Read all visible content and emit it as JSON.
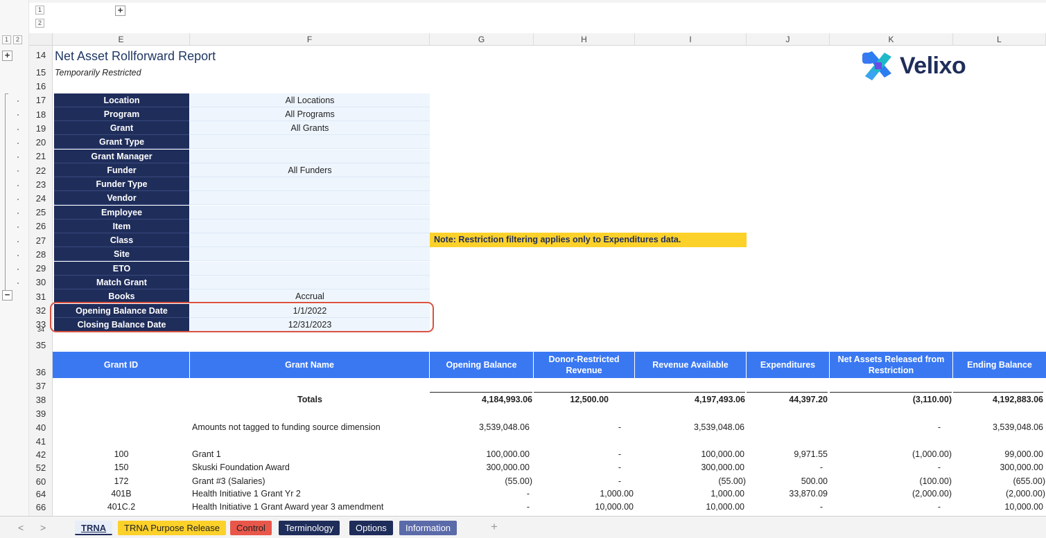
{
  "outline": {
    "levels": [
      "1",
      "2"
    ],
    "expand_label": "+",
    "collapse_label": "−"
  },
  "columns": [
    "E",
    "F",
    "G",
    "H",
    "I",
    "J",
    "K",
    "L"
  ],
  "rows": {
    "r14": "14",
    "r15": "15",
    "r16": "16",
    "r17": "17",
    "r18": "18",
    "r19": "19",
    "r20": "20",
    "r21": "21",
    "r22": "22",
    "r23": "23",
    "r24": "24",
    "r25": "25",
    "r26": "26",
    "r27": "27",
    "r28": "28",
    "r29": "29",
    "r30": "30",
    "r31": "31",
    "r32": "32",
    "r33": "33",
    "r34": "34",
    "r35": "35",
    "r36": "36",
    "r37": "37",
    "r38": "38",
    "r39": "39",
    "r40": "40",
    "r41": "41",
    "r42": "42",
    "r52": "52",
    "r60": "60",
    "r64": "64",
    "r66": "66"
  },
  "report": {
    "title": "Net Asset Rollforward Report",
    "subtitle": "Temporarily Restricted",
    "logo_text": "Velixo"
  },
  "filters": [
    {
      "label": "Location",
      "value": "All Locations"
    },
    {
      "label": "Program",
      "value": "All Programs"
    },
    {
      "label": "Grant",
      "value": "All Grants"
    },
    {
      "label": "Grant Type",
      "value": ""
    },
    {
      "label": "Grant Manager",
      "value": ""
    },
    {
      "label": "Funder",
      "value": "All Funders"
    },
    {
      "label": "Funder Type",
      "value": ""
    },
    {
      "label": "Vendor",
      "value": ""
    },
    {
      "label": "Employee",
      "value": ""
    },
    {
      "label": "Item",
      "value": ""
    },
    {
      "label": "Class",
      "value": ""
    },
    {
      "label": "Site",
      "value": ""
    },
    {
      "label": "ETO",
      "value": ""
    },
    {
      "label": "Match Grant",
      "value": ""
    },
    {
      "label": "Books",
      "value": "Accrual"
    },
    {
      "label": "Opening Balance Date",
      "value": "1/1/2022"
    },
    {
      "label": "Closing Balance Date",
      "value": "12/31/2023"
    }
  ],
  "note": "Note: Restriction filtering applies only to Expenditures data.",
  "table": {
    "headers": [
      "Grant ID",
      "Grant Name",
      "Opening Balance",
      "Donor-Restricted Revenue",
      "Revenue Available",
      "Expenditures",
      "Net Assets Released from Restriction",
      "Ending Balance"
    ],
    "totals": {
      "label": "Totals",
      "opening": "4,184,993.06",
      "donor": "12,500.00",
      "available": "4,197,493.06",
      "expend": "44,397.20",
      "released": "(3,110.00)",
      "ending": "4,192,883.06"
    },
    "untagged": {
      "label": "Amounts not tagged to funding source dimension",
      "opening": "3,539,048.06",
      "donor": "-",
      "available": "3,539,048.06",
      "expend": "",
      "released": "-",
      "ending": "3,539,048.06"
    },
    "grants": [
      {
        "id": "100",
        "name": "Grant 1",
        "opening": "100,000.00",
        "donor": "-",
        "available": "100,000.00",
        "expend": "9,971.55",
        "released": "(1,000.00)",
        "ending": "99,000.00"
      },
      {
        "id": "150",
        "name": "Skuski Foundation Award",
        "opening": "300,000.00",
        "donor": "-",
        "available": "300,000.00",
        "expend": "-",
        "released": "-",
        "ending": "300,000.00"
      },
      {
        "id": "172",
        "name": "Grant #3 (Salaries)",
        "opening": "(55.00)",
        "donor": "-",
        "available": "(55.00)",
        "expend": "500.00",
        "released": "(100.00)",
        "ending": "(655.00)"
      },
      {
        "id": "401B",
        "name": "Health Initiative 1 Grant Yr 2",
        "opening": "-",
        "donor": "1,000.00",
        "available": "1,000.00",
        "expend": "33,870.09",
        "released": "(2,000.00)",
        "ending": "(2,000.00)"
      },
      {
        "id": "401C.2",
        "name": "Health Initiative 1 Grant Award year 3 amendment",
        "opening": "-",
        "donor": "10,000.00",
        "available": "10,000.00",
        "expend": "-",
        "released": "-",
        "ending": "10,000.00"
      }
    ]
  },
  "sheet_tabs": [
    {
      "label": "TRNA",
      "bg": "#e8eef8",
      "fg": "#1f2d5a"
    },
    {
      "label": "TRNA Purpose Release",
      "bg": "#fcd12a",
      "fg": "#222222"
    },
    {
      "label": "Control",
      "bg": "#e8574a",
      "fg": "#222222"
    },
    {
      "label": "Terminology",
      "bg": "#1f2d5a",
      "fg": "#ffffff"
    },
    {
      "label": "Options",
      "bg": "#1f2d5a",
      "fg": "#ffffff"
    },
    {
      "label": "Information",
      "bg": "#5b6aa8",
      "fg": "#ffffff"
    }
  ],
  "nav": {
    "prev": "<",
    "next": ">",
    "add": "+"
  },
  "colors": {
    "navy": "#1f2d5a",
    "header_blue": "#3a78f2",
    "note_yellow": "#fcd12a",
    "highlight_red": "#d9513f"
  }
}
